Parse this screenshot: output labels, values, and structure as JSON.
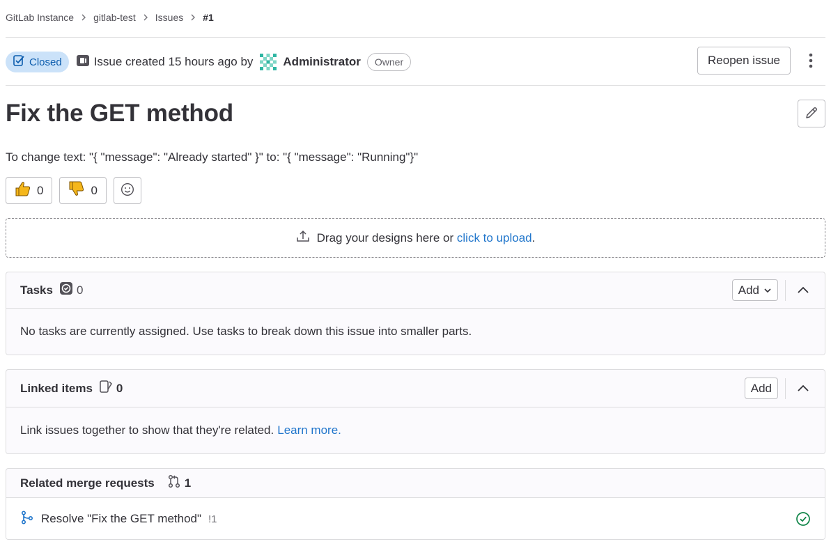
{
  "breadcrumb": {
    "items": [
      "GitLab Instance",
      "gitlab-test",
      "Issues",
      "#1"
    ]
  },
  "issue": {
    "status": "Closed",
    "created_text": "Issue created 15 hours ago by",
    "author": "Administrator",
    "author_role": "Owner",
    "reopen_label": "Reopen issue",
    "title": "Fix the GET method",
    "description": "To change text: \"{ \"message\": \"Already started\" }\" to: \"{ \"message\": \"Running\"}\""
  },
  "reactions": {
    "thumbs_up": "0",
    "thumbs_down": "0"
  },
  "dropzone": {
    "text": "Drag your designs here or",
    "link": "click to upload",
    "suffix": "."
  },
  "tasks": {
    "title": "Tasks",
    "count": "0",
    "add_label": "Add",
    "empty_text": "No tasks are currently assigned. Use tasks to break down this issue into smaller parts."
  },
  "linked_items": {
    "title": "Linked items",
    "count": "0",
    "add_label": "Add",
    "body_text": "Link issues together to show that they're related.",
    "learn_more": "Learn more."
  },
  "related_mrs": {
    "title": "Related merge requests",
    "count": "1",
    "items": [
      {
        "title": "Resolve \"Fix the GET method\"",
        "ref": "!1",
        "status_icon": "check-circle-icon"
      }
    ]
  },
  "colors": {
    "accent_blue": "#1f75cb",
    "closed_badge_bg": "#cbe2f9",
    "success_green": "#108548"
  }
}
